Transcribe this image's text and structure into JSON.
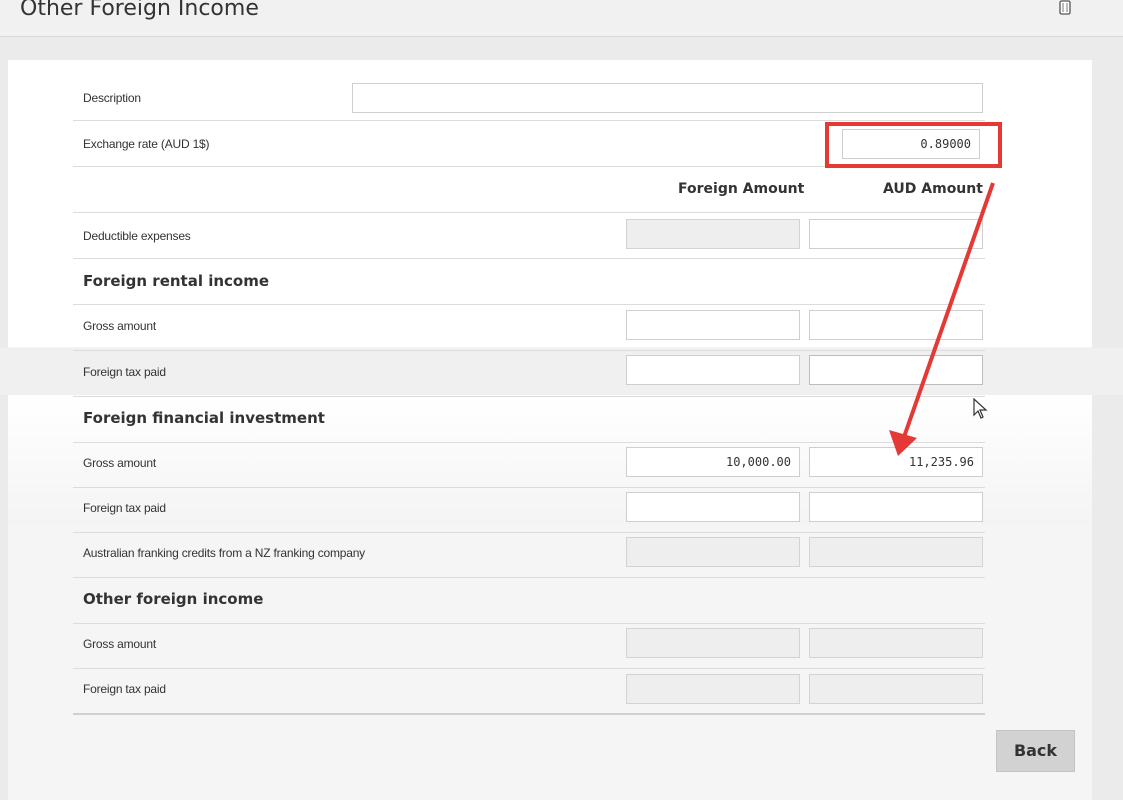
{
  "header": {
    "title": "Other Foreign Income",
    "icons": [
      "trash-icon"
    ]
  },
  "form": {
    "description": {
      "label": "Description",
      "value": ""
    },
    "exchange_rate": {
      "label": "Exchange rate (AUD 1$)",
      "value": "0.89000"
    },
    "columns": {
      "foreign": "Foreign Amount",
      "aud": "AUD Amount"
    },
    "deductible_expenses": {
      "label": "Deductible expenses",
      "foreign": "",
      "aud": ""
    },
    "foreign_rental_income": {
      "title": "Foreign rental income",
      "gross_amount": {
        "label": "Gross amount",
        "foreign": "",
        "aud": ""
      },
      "foreign_tax_paid": {
        "label": "Foreign tax paid",
        "foreign": "",
        "aud": ""
      }
    },
    "foreign_financial_investment": {
      "title": "Foreign financial investment",
      "gross_amount": {
        "label": "Gross amount",
        "foreign": "10,000.00",
        "aud": "11,235.96"
      },
      "foreign_tax_paid": {
        "label": "Foreign tax paid",
        "foreign": "",
        "aud": ""
      },
      "franking_credits": {
        "label": "Australian franking credits from a NZ franking company",
        "foreign": "",
        "aud": ""
      }
    },
    "other_foreign_income": {
      "title": "Other foreign income",
      "gross_amount": {
        "label": "Gross amount",
        "foreign": "",
        "aud": ""
      },
      "foreign_tax_paid": {
        "label": "Foreign tax paid",
        "foreign": "",
        "aud": ""
      }
    }
  },
  "actions": {
    "back_label": "Back"
  },
  "annotation": {
    "color": "#e53935",
    "icons": [
      "arrow-icon",
      "cursor-icon"
    ]
  }
}
